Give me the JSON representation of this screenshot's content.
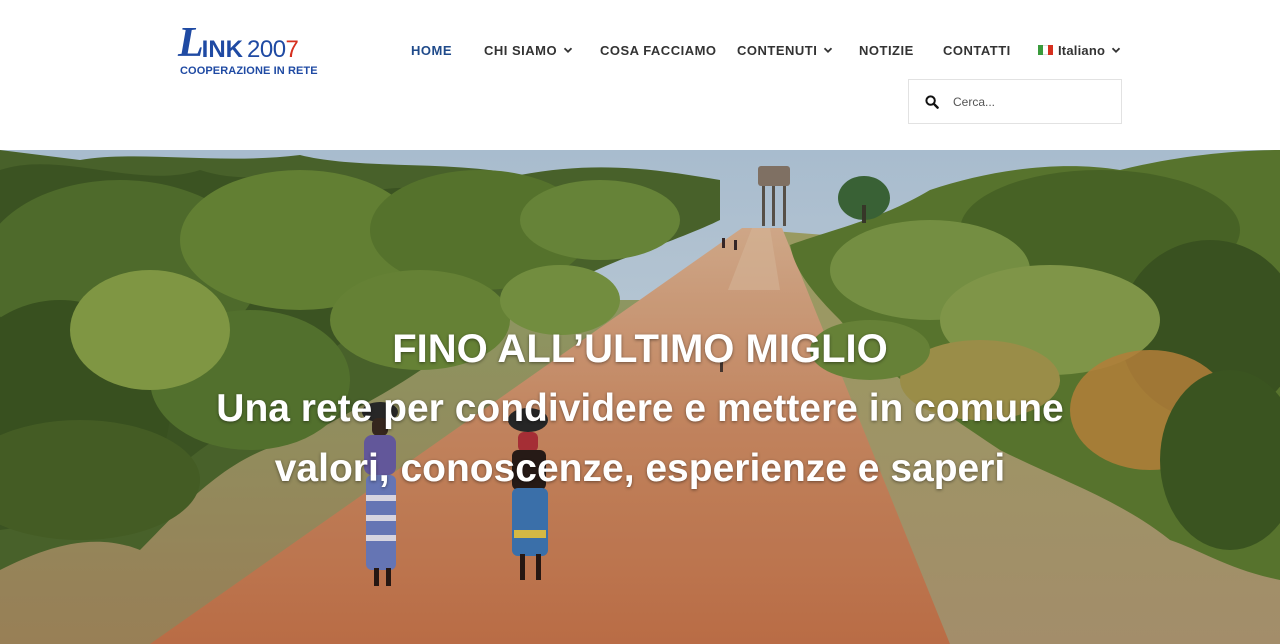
{
  "logo": {
    "l": "L",
    "ink": "INK",
    "year_a": "200",
    "year_b": "7",
    "subtitle": "COOPERAZIONE IN RETE"
  },
  "nav": {
    "items": [
      {
        "label": "HOME",
        "active": true
      },
      {
        "label": "CHI SIAMO",
        "dropdown": true
      },
      {
        "label": "COSA FACCIAMO"
      },
      {
        "label": "CONTENUTI",
        "dropdown": true
      },
      {
        "label": "NOTIZIE"
      },
      {
        "label": "CONTATTI"
      }
    ],
    "language": {
      "label": "Italiano",
      "flag": "italy-flag-icon"
    }
  },
  "search": {
    "placeholder": "Cerca...",
    "value": "",
    "icon": "search-icon"
  },
  "hero": {
    "title": "FINO ALL’ULTIMO MIGLIO",
    "line1": "Una rete per condividere e mettere in comune",
    "line2": "valori, conoscenze, esperienze e saperi"
  },
  "colors": {
    "brand_blue": "#1f4aa3",
    "active_nav": "#1f4a8a",
    "brand_red": "#d6301f",
    "nav_text": "#333333"
  }
}
